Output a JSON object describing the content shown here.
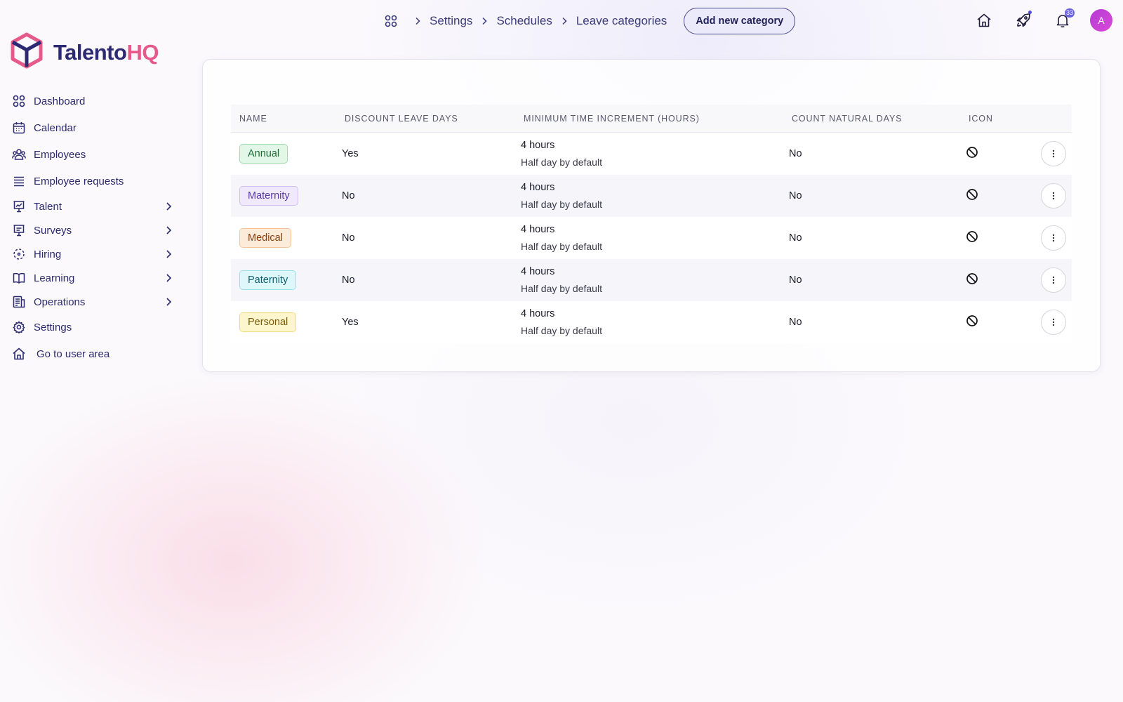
{
  "brand": {
    "name_part1": "Talento",
    "name_part2": "HQ",
    "primary": "#2d2a73",
    "accent": "#e55a89"
  },
  "breadcrumb": {
    "home_icon": "apps-grid-icon",
    "items": [
      "Settings",
      "Schedules",
      "Leave categories"
    ]
  },
  "header": {
    "add_button_label": "Add new category",
    "notifications_count": "33",
    "avatar_initial": "A"
  },
  "sidebar": {
    "items": [
      {
        "label": "Dashboard",
        "icon": "grid-icon",
        "expandable": false
      },
      {
        "label": "Calendar",
        "icon": "calendar-icon",
        "expandable": false
      },
      {
        "label": "Employees",
        "icon": "users-icon",
        "expandable": false
      },
      {
        "label": "Employee requests",
        "icon": "list-icon",
        "expandable": false
      },
      {
        "label": "Talent",
        "icon": "presentation-icon",
        "expandable": true
      },
      {
        "label": "Surveys",
        "icon": "survey-icon",
        "expandable": true
      },
      {
        "label": "Hiring",
        "icon": "hiring-icon",
        "expandable": true
      },
      {
        "label": "Learning",
        "icon": "book-icon",
        "expandable": true
      },
      {
        "label": "Operations",
        "icon": "operations-icon",
        "expandable": true
      },
      {
        "label": "Settings",
        "icon": "gear-icon",
        "expandable": false
      },
      {
        "label": "Go to user area",
        "icon": "home-icon",
        "expandable": false
      }
    ]
  },
  "table": {
    "columns": [
      "NAME",
      "DISCOUNT LEAVE DAYS",
      "MINIMUM TIME INCREMENT (HOURS)",
      "COUNT NATURAL DAYS",
      "ICON"
    ],
    "rows": [
      {
        "name": "Annual",
        "discount": "Yes",
        "increment": "4 hours",
        "increment_note": "Half day by default",
        "natural_days": "No",
        "icon": "ban-icon",
        "tag_bg": "#e3f7e8",
        "tag_border": "#9fdcae",
        "tag_color": "#1c6b35"
      },
      {
        "name": "Maternity",
        "discount": "No",
        "increment": "4 hours",
        "increment_note": "Half day by default",
        "natural_days": "No",
        "icon": "ban-icon",
        "tag_bg": "#efe9fb",
        "tag_border": "#cfc0f0",
        "tag_color": "#5b3aa4"
      },
      {
        "name": "Medical",
        "discount": "No",
        "increment": "4 hours",
        "increment_note": "Half day by default",
        "natural_days": "No",
        "icon": "ban-icon",
        "tag_bg": "#fdebd9",
        "tag_border": "#f4c59a",
        "tag_color": "#8a3f10"
      },
      {
        "name": "Paternity",
        "discount": "No",
        "increment": "4 hours",
        "increment_note": "Half day by default",
        "natural_days": "No",
        "icon": "ban-icon",
        "tag_bg": "#def7fb",
        "tag_border": "#96e0ec",
        "tag_color": "#0f5f6e"
      },
      {
        "name": "Personal",
        "discount": "Yes",
        "increment": "4 hours",
        "increment_note": "Half day by default",
        "natural_days": "No",
        "icon": "ban-icon",
        "tag_bg": "#fdf6cc",
        "tag_border": "#f0dc7c",
        "tag_color": "#7a5a0a"
      }
    ]
  }
}
